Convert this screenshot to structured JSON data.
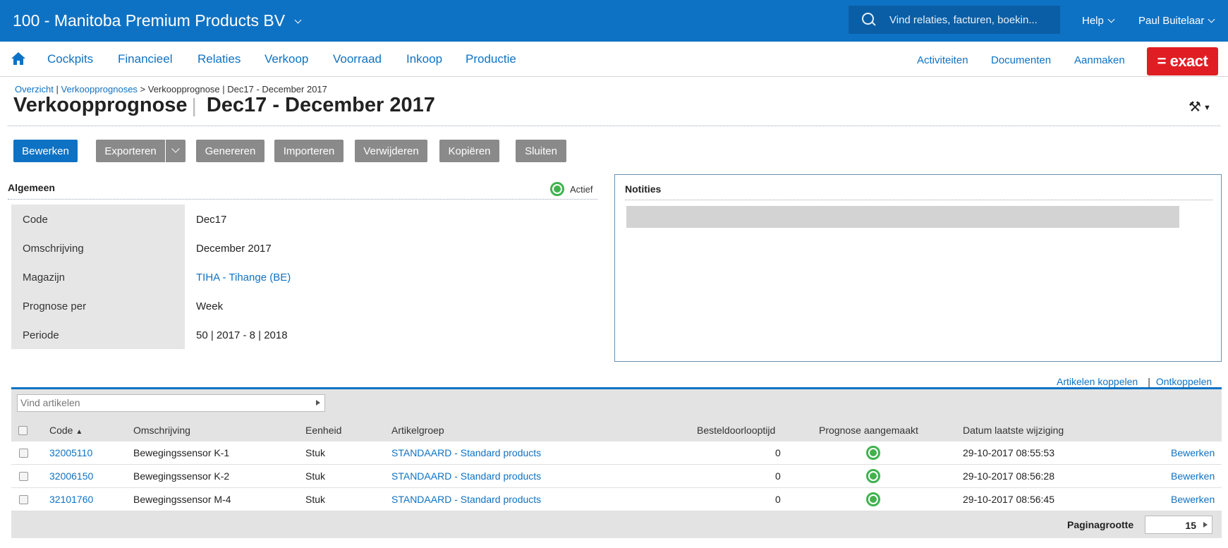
{
  "topbar": {
    "company": "100 - Manitoba Premium Products BV",
    "search_placeholder": "Vind relaties, facturen, boekin...",
    "help": "Help",
    "user": "Paul Buitelaar"
  },
  "nav": {
    "items": [
      "Cockpits",
      "Financieel",
      "Relaties",
      "Verkoop",
      "Voorraad",
      "Inkoop",
      "Productie"
    ],
    "right": [
      "Activiteiten",
      "Documenten",
      "Aanmaken"
    ],
    "logo": "= exact"
  },
  "breadcrumb": {
    "overzicht": "Overzicht",
    "sep1": " | ",
    "verkoopprognoses": "Verkoopprognoses",
    "rest": " > Verkoopprognose | Dec17 - December 2017"
  },
  "title": {
    "main": "Verkoopprognose",
    "sub": "Dec17 - December 2017"
  },
  "toolbar": {
    "bewerken": "Bewerken",
    "exporteren": "Exporteren",
    "genereren": "Genereren",
    "importeren": "Importeren",
    "verwijderen": "Verwijderen",
    "kopieren": "Kopiëren",
    "sluiten": "Sluiten"
  },
  "algemeen": {
    "title": "Algemeen",
    "status": "Actief",
    "fields": [
      {
        "label": "Code",
        "value": "Dec17"
      },
      {
        "label": "Omschrijving",
        "value": "December 2017"
      },
      {
        "label": "Magazijn",
        "value": "TIHA - Tihange (BE)"
      },
      {
        "label": "Prognose per",
        "value": "Week"
      },
      {
        "label": "Periode",
        "value": "50 | 2017 - 8 | 2018"
      }
    ]
  },
  "notities": {
    "title": "Notities"
  },
  "grid": {
    "link_koppelen": "Artikelen koppelen",
    "link_sep": "|",
    "link_ontkoppelen": "Ontkoppelen",
    "find_placeholder": "Vind artikelen",
    "columns": {
      "code": "Code",
      "omschrijving": "Omschrijving",
      "eenheid": "Eenheid",
      "artikelgroep": "Artikelgroep",
      "besteldoorlooptijd": "Besteldoorlooptijd",
      "prognose": "Prognose aangemaakt",
      "datum": "Datum laatste wijziging"
    },
    "rows": [
      {
        "code": "32005110",
        "omschrijving": "Bewegingssensor K-1",
        "eenheid": "Stuk",
        "artikelgroep": "STANDAARD - Standard products",
        "besteldoorlooptijd": "0",
        "datum": "29-10-2017 08:55:53",
        "actie": "Bewerken"
      },
      {
        "code": "32006150",
        "omschrijving": "Bewegingssensor K-2",
        "eenheid": "Stuk",
        "artikelgroep": "STANDAARD - Standard products",
        "besteldoorlooptijd": "0",
        "datum": "29-10-2017 08:56:28",
        "actie": "Bewerken"
      },
      {
        "code": "32101760",
        "omschrijving": "Bewegingssensor M-4",
        "eenheid": "Stuk",
        "artikelgroep": "STANDAARD - Standard products",
        "besteldoorlooptijd": "0",
        "datum": "29-10-2017 08:56:45",
        "actie": "Bewerken"
      }
    ],
    "pagesize_label": "Paginagrootte",
    "pagesize": "15"
  },
  "colors": {
    "brand_blue": "#0e72c4",
    "exact_red": "#e01d23",
    "status_green": "#3fb34f"
  }
}
